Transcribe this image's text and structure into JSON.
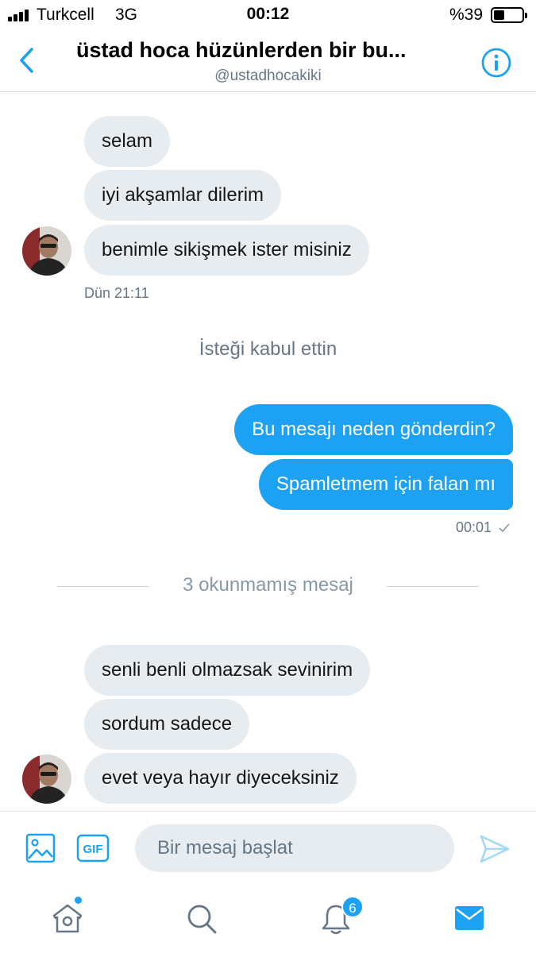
{
  "status": {
    "carrier": "Turkcell",
    "network": "3G",
    "time": "00:12",
    "battery_text": "%39",
    "battery_level": 0.39
  },
  "header": {
    "title": "üstad hoca hüzünlerden bir bu...",
    "handle": "@ustadhocakiki"
  },
  "conversation": {
    "group1": [
      "selam",
      "iyi akşamlar dilerim",
      "benimle sikişmek ister misiniz"
    ],
    "group1_time": "Dün 21:11",
    "request_note": "İsteği kabul ettin",
    "sent": [
      "Bu mesajı neden gönderdin?",
      "Spamletmem için falan mı"
    ],
    "sent_time": "00:01",
    "unread_label": "3 okunmamış mesaj",
    "group2": [
      "senli benli olmazsak sevinirim",
      "sordum sadece",
      "evet veya hayır diyeceksiniz"
    ]
  },
  "composer": {
    "placeholder": "Bir mesaj başlat",
    "gif_label": "GIF"
  },
  "tabbar": {
    "notifications_badge": "6"
  },
  "colors": {
    "accent": "#1da1f2",
    "incoming_bubble": "#e6ecf0",
    "secondary_text": "#657786"
  }
}
